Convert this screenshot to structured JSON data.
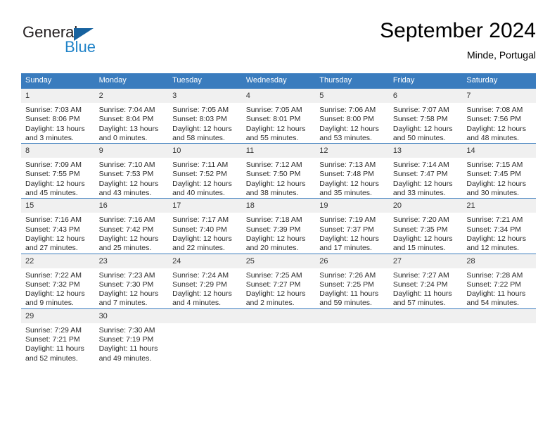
{
  "brand": {
    "name_part1": "General",
    "name_part2": "Blue",
    "logo_icon": "triangle-icon",
    "color_dark": "#231f20",
    "color_blue": "#2083c8",
    "color_triangle": "#17629f"
  },
  "header": {
    "month_title": "September 2024",
    "location": "Minde, Portugal"
  },
  "theme": {
    "header_blue": "#3a7cbe",
    "daynum_gray": "#f0f0f0",
    "text_dark": "#2b2b2b"
  },
  "calendar": {
    "weekday_headers": [
      "Sunday",
      "Monday",
      "Tuesday",
      "Wednesday",
      "Thursday",
      "Friday",
      "Saturday"
    ],
    "weeks": [
      [
        {
          "day": "1",
          "sunrise": "Sunrise: 7:03 AM",
          "sunset": "Sunset: 8:06 PM",
          "daylight_line1": "Daylight: 13 hours",
          "daylight_line2": "and 3 minutes."
        },
        {
          "day": "2",
          "sunrise": "Sunrise: 7:04 AM",
          "sunset": "Sunset: 8:04 PM",
          "daylight_line1": "Daylight: 13 hours",
          "daylight_line2": "and 0 minutes."
        },
        {
          "day": "3",
          "sunrise": "Sunrise: 7:05 AM",
          "sunset": "Sunset: 8:03 PM",
          "daylight_line1": "Daylight: 12 hours",
          "daylight_line2": "and 58 minutes."
        },
        {
          "day": "4",
          "sunrise": "Sunrise: 7:05 AM",
          "sunset": "Sunset: 8:01 PM",
          "daylight_line1": "Daylight: 12 hours",
          "daylight_line2": "and 55 minutes."
        },
        {
          "day": "5",
          "sunrise": "Sunrise: 7:06 AM",
          "sunset": "Sunset: 8:00 PM",
          "daylight_line1": "Daylight: 12 hours",
          "daylight_line2": "and 53 minutes."
        },
        {
          "day": "6",
          "sunrise": "Sunrise: 7:07 AM",
          "sunset": "Sunset: 7:58 PM",
          "daylight_line1": "Daylight: 12 hours",
          "daylight_line2": "and 50 minutes."
        },
        {
          "day": "7",
          "sunrise": "Sunrise: 7:08 AM",
          "sunset": "Sunset: 7:56 PM",
          "daylight_line1": "Daylight: 12 hours",
          "daylight_line2": "and 48 minutes."
        }
      ],
      [
        {
          "day": "8",
          "sunrise": "Sunrise: 7:09 AM",
          "sunset": "Sunset: 7:55 PM",
          "daylight_line1": "Daylight: 12 hours",
          "daylight_line2": "and 45 minutes."
        },
        {
          "day": "9",
          "sunrise": "Sunrise: 7:10 AM",
          "sunset": "Sunset: 7:53 PM",
          "daylight_line1": "Daylight: 12 hours",
          "daylight_line2": "and 43 minutes."
        },
        {
          "day": "10",
          "sunrise": "Sunrise: 7:11 AM",
          "sunset": "Sunset: 7:52 PM",
          "daylight_line1": "Daylight: 12 hours",
          "daylight_line2": "and 40 minutes."
        },
        {
          "day": "11",
          "sunrise": "Sunrise: 7:12 AM",
          "sunset": "Sunset: 7:50 PM",
          "daylight_line1": "Daylight: 12 hours",
          "daylight_line2": "and 38 minutes."
        },
        {
          "day": "12",
          "sunrise": "Sunrise: 7:13 AM",
          "sunset": "Sunset: 7:48 PM",
          "daylight_line1": "Daylight: 12 hours",
          "daylight_line2": "and 35 minutes."
        },
        {
          "day": "13",
          "sunrise": "Sunrise: 7:14 AM",
          "sunset": "Sunset: 7:47 PM",
          "daylight_line1": "Daylight: 12 hours",
          "daylight_line2": "and 33 minutes."
        },
        {
          "day": "14",
          "sunrise": "Sunrise: 7:15 AM",
          "sunset": "Sunset: 7:45 PM",
          "daylight_line1": "Daylight: 12 hours",
          "daylight_line2": "and 30 minutes."
        }
      ],
      [
        {
          "day": "15",
          "sunrise": "Sunrise: 7:16 AM",
          "sunset": "Sunset: 7:43 PM",
          "daylight_line1": "Daylight: 12 hours",
          "daylight_line2": "and 27 minutes."
        },
        {
          "day": "16",
          "sunrise": "Sunrise: 7:16 AM",
          "sunset": "Sunset: 7:42 PM",
          "daylight_line1": "Daylight: 12 hours",
          "daylight_line2": "and 25 minutes."
        },
        {
          "day": "17",
          "sunrise": "Sunrise: 7:17 AM",
          "sunset": "Sunset: 7:40 PM",
          "daylight_line1": "Daylight: 12 hours",
          "daylight_line2": "and 22 minutes."
        },
        {
          "day": "18",
          "sunrise": "Sunrise: 7:18 AM",
          "sunset": "Sunset: 7:39 PM",
          "daylight_line1": "Daylight: 12 hours",
          "daylight_line2": "and 20 minutes."
        },
        {
          "day": "19",
          "sunrise": "Sunrise: 7:19 AM",
          "sunset": "Sunset: 7:37 PM",
          "daylight_line1": "Daylight: 12 hours",
          "daylight_line2": "and 17 minutes."
        },
        {
          "day": "20",
          "sunrise": "Sunrise: 7:20 AM",
          "sunset": "Sunset: 7:35 PM",
          "daylight_line1": "Daylight: 12 hours",
          "daylight_line2": "and 15 minutes."
        },
        {
          "day": "21",
          "sunrise": "Sunrise: 7:21 AM",
          "sunset": "Sunset: 7:34 PM",
          "daylight_line1": "Daylight: 12 hours",
          "daylight_line2": "and 12 minutes."
        }
      ],
      [
        {
          "day": "22",
          "sunrise": "Sunrise: 7:22 AM",
          "sunset": "Sunset: 7:32 PM",
          "daylight_line1": "Daylight: 12 hours",
          "daylight_line2": "and 9 minutes."
        },
        {
          "day": "23",
          "sunrise": "Sunrise: 7:23 AM",
          "sunset": "Sunset: 7:30 PM",
          "daylight_line1": "Daylight: 12 hours",
          "daylight_line2": "and 7 minutes."
        },
        {
          "day": "24",
          "sunrise": "Sunrise: 7:24 AM",
          "sunset": "Sunset: 7:29 PM",
          "daylight_line1": "Daylight: 12 hours",
          "daylight_line2": "and 4 minutes."
        },
        {
          "day": "25",
          "sunrise": "Sunrise: 7:25 AM",
          "sunset": "Sunset: 7:27 PM",
          "daylight_line1": "Daylight: 12 hours",
          "daylight_line2": "and 2 minutes."
        },
        {
          "day": "26",
          "sunrise": "Sunrise: 7:26 AM",
          "sunset": "Sunset: 7:25 PM",
          "daylight_line1": "Daylight: 11 hours",
          "daylight_line2": "and 59 minutes."
        },
        {
          "day": "27",
          "sunrise": "Sunrise: 7:27 AM",
          "sunset": "Sunset: 7:24 PM",
          "daylight_line1": "Daylight: 11 hours",
          "daylight_line2": "and 57 minutes."
        },
        {
          "day": "28",
          "sunrise": "Sunrise: 7:28 AM",
          "sunset": "Sunset: 7:22 PM",
          "daylight_line1": "Daylight: 11 hours",
          "daylight_line2": "and 54 minutes."
        }
      ],
      [
        {
          "day": "29",
          "sunrise": "Sunrise: 7:29 AM",
          "sunset": "Sunset: 7:21 PM",
          "daylight_line1": "Daylight: 11 hours",
          "daylight_line2": "and 52 minutes."
        },
        {
          "day": "30",
          "sunrise": "Sunrise: 7:30 AM",
          "sunset": "Sunset: 7:19 PM",
          "daylight_line1": "Daylight: 11 hours",
          "daylight_line2": "and 49 minutes."
        },
        {
          "day": "",
          "sunrise": "",
          "sunset": "",
          "daylight_line1": "",
          "daylight_line2": ""
        },
        {
          "day": "",
          "sunrise": "",
          "sunset": "",
          "daylight_line1": "",
          "daylight_line2": ""
        },
        {
          "day": "",
          "sunrise": "",
          "sunset": "",
          "daylight_line1": "",
          "daylight_line2": ""
        },
        {
          "day": "",
          "sunrise": "",
          "sunset": "",
          "daylight_line1": "",
          "daylight_line2": ""
        },
        {
          "day": "",
          "sunrise": "",
          "sunset": "",
          "daylight_line1": "",
          "daylight_line2": ""
        }
      ]
    ]
  }
}
